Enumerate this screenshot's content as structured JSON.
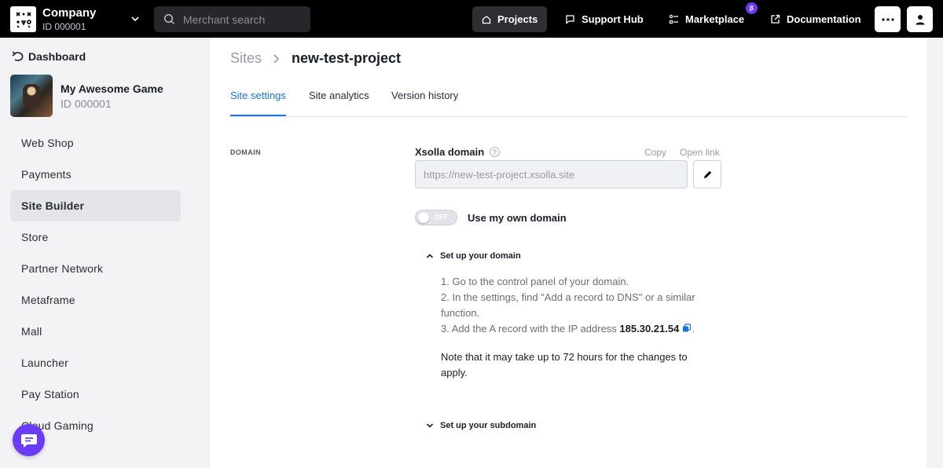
{
  "topbar": {
    "company_name": "Company",
    "company_id": "ID 000001",
    "search_placeholder": "Merchant search",
    "nav": {
      "projects": "Projects",
      "support_hub": "Support Hub",
      "marketplace": "Marketplace",
      "documentation": "Documentation"
    },
    "beta_badge": "β",
    "more_icon": "more-icon",
    "user_icon": "user-icon"
  },
  "sidebar": {
    "dashboard_label": "Dashboard",
    "project_name": "My Awesome Game",
    "project_id": "ID 000001",
    "items": [
      {
        "label": "Web Shop"
      },
      {
        "label": "Payments"
      },
      {
        "label": "Site Builder",
        "active": true
      },
      {
        "label": "Store"
      },
      {
        "label": "Partner Network"
      },
      {
        "label": "Metaframe"
      },
      {
        "label": "Mall"
      },
      {
        "label": "Launcher"
      },
      {
        "label": "Pay Station"
      },
      {
        "label": "Cloud Gaming"
      }
    ]
  },
  "main": {
    "breadcrumb_parent": "Sites",
    "breadcrumb_current": "new-test-project",
    "tabs": [
      {
        "label": "Site settings",
        "active": true
      },
      {
        "label": "Site analytics"
      },
      {
        "label": "Version history"
      }
    ],
    "section_label": "DOMAIN",
    "field_label": "Xsolla domain",
    "copy_link": "Copy",
    "open_link": "Open link",
    "domain_value": "https://new-test-project.xsolla.site",
    "toggle_state": "OFF",
    "toggle_label": "Use my own domain",
    "setup_domain_heading": "Set up your domain",
    "steps": {
      "step1": "1. Go to the control panel of your domain.",
      "step2a": "2. In the settings, find \"Add a record to DNS\" or a similar",
      "step2b": "function.",
      "step3_prefix": "3. Add the A record with the IP address",
      "ip_address": "185.30.21.54",
      "step3_suffix": "."
    },
    "note": "Note that it may take up to 72 hours for the changes to apply.",
    "setup_subdomain_heading": "Set up your subdomain"
  },
  "colors": {
    "accent": "#1a73e0",
    "purple": "#6a3cf7",
    "topbar": "#000000"
  }
}
